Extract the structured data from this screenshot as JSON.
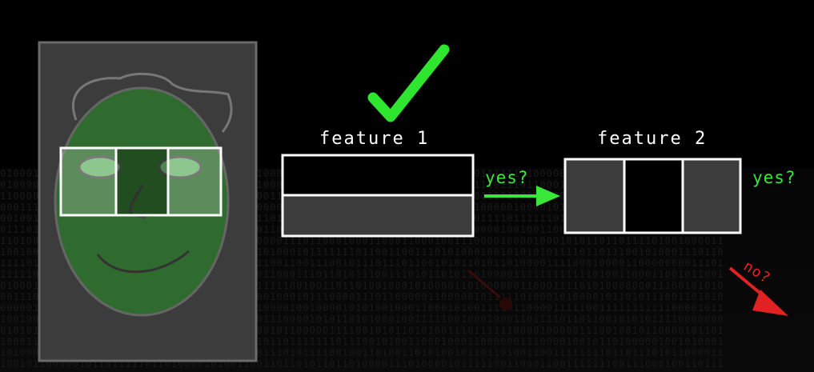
{
  "features": [
    {
      "label": "feature 1"
    },
    {
      "label": "feature 2"
    }
  ],
  "decisions": {
    "yes_label": "yes?",
    "no_label": "no?"
  },
  "colors": {
    "face_fill": "#2f6b2f",
    "eye_fill": "#6fb86f",
    "yes_green": "#39e639",
    "no_red": "#e22222",
    "panel_gray": "#3c3c3c"
  },
  "icons": [
    "checkmark-icon",
    "right-arrow-icon",
    "down-right-arrow-icon"
  ]
}
